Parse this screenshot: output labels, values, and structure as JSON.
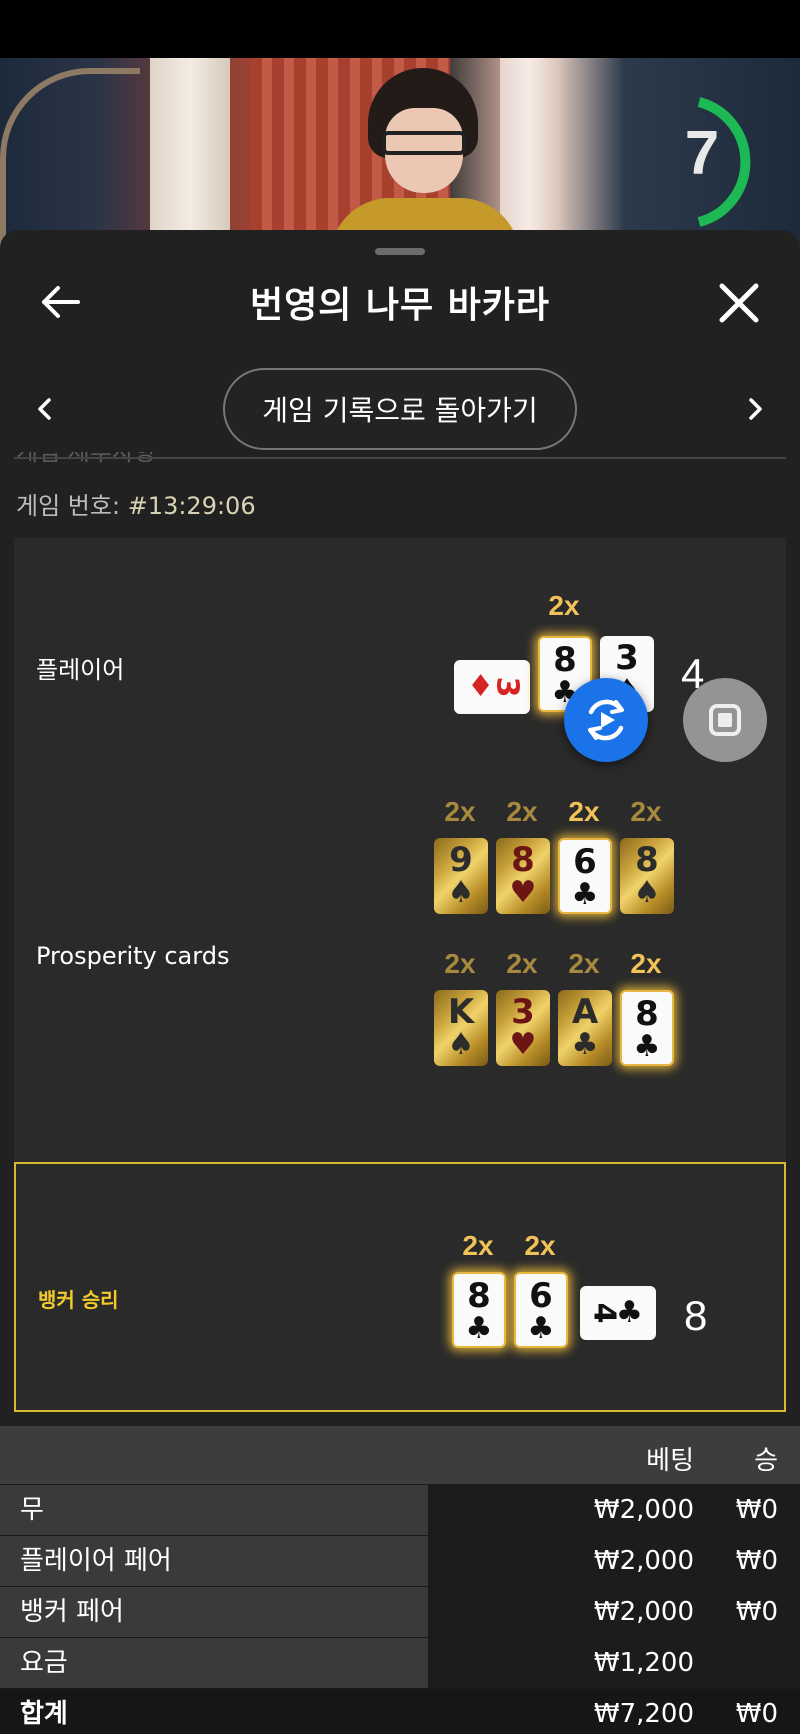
{
  "timer": {
    "value": "7"
  },
  "header": {
    "title": "번영의 나무 바카라"
  },
  "nav": {
    "history_button": "게임 기록으로 돌아가기"
  },
  "game": {
    "number_label": "게임 번호:",
    "number_value": "#13:29:06"
  },
  "rounds": {
    "player": {
      "label": "플레이어",
      "score": "4",
      "multipliers": [
        "2x"
      ],
      "cards": [
        {
          "rank": "3",
          "suit": "♦",
          "color": "red",
          "orientation": "sideways"
        },
        {
          "rank": "8",
          "suit": "♣",
          "color": "black",
          "style": "glow"
        },
        {
          "rank": "3",
          "suit": "♠",
          "color": "black"
        }
      ]
    },
    "prosperity": {
      "label": "Prosperity cards",
      "multipliers_row1": [
        "2x",
        "2x",
        "2x",
        "2x"
      ],
      "multipliers_row2": [
        "2x",
        "2x",
        "2x",
        "2x"
      ],
      "cards_row1": [
        {
          "rank": "9",
          "suit": "♠",
          "style": "gold"
        },
        {
          "rank": "8",
          "suit": "♥",
          "style": "gold-red"
        },
        {
          "rank": "6",
          "suit": "♣",
          "style": "white-glow"
        },
        {
          "rank": "8",
          "suit": "♠",
          "style": "gold"
        }
      ],
      "cards_row2": [
        {
          "rank": "K",
          "suit": "♠",
          "style": "gold"
        },
        {
          "rank": "3",
          "suit": "♥",
          "style": "gold-red"
        },
        {
          "rank": "A",
          "suit": "♣",
          "style": "gold"
        },
        {
          "rank": "8",
          "suit": "♣",
          "style": "white-glow"
        }
      ]
    },
    "banker": {
      "label": "뱅커 승리",
      "score": "8",
      "multipliers": [
        "2x",
        "2x"
      ],
      "cards": [
        {
          "rank": "8",
          "suit": "♣",
          "style": "glow"
        },
        {
          "rank": "6",
          "suit": "♣",
          "style": "glow"
        },
        {
          "rank": "4",
          "suit": "♣",
          "orientation": "sideways"
        }
      ]
    }
  },
  "bets": {
    "columns": {
      "bet": "베팅",
      "win": "승"
    },
    "rows": [
      {
        "label": "무",
        "bet": "₩2,000",
        "win": "₩0"
      },
      {
        "label": "플레이어 페어",
        "bet": "₩2,000",
        "win": "₩0"
      },
      {
        "label": "뱅커 페어",
        "bet": "₩2,000",
        "win": "₩0"
      },
      {
        "label": "요금",
        "bet": "₩1,200",
        "win": ""
      }
    ],
    "total": {
      "label": "합계",
      "bet": "₩7,200",
      "win": "₩0"
    }
  },
  "colors": {
    "accent_gold": "#f0c257",
    "winner_border": "#d9b92e",
    "replay_blue": "#1a73e8",
    "timer_green": "#1db954"
  }
}
